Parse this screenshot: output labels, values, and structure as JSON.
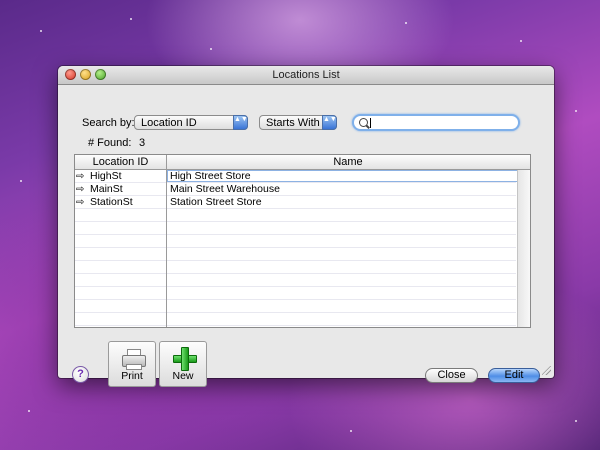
{
  "window": {
    "title": "Locations List"
  },
  "search_bar": {
    "search_by_label": "Search by:",
    "field_value": "Location ID",
    "operator_value": "Starts With",
    "query_value": ""
  },
  "found": {
    "label": "# Found:",
    "count": "3"
  },
  "table": {
    "columns": [
      "Location ID",
      "Name"
    ],
    "rows": [
      {
        "id": "HighSt",
        "name": "High Street Store"
      },
      {
        "id": "MainSt",
        "name": "Main Street Warehouse"
      },
      {
        "id": "StationSt",
        "name": "Station Street Store"
      }
    ]
  },
  "buttons": {
    "help": "?",
    "print": "Print",
    "new": "New",
    "close": "Close",
    "edit": "Edit"
  },
  "icons": {
    "row_arrow": "⇨",
    "popup_arrows": "▲▼"
  }
}
